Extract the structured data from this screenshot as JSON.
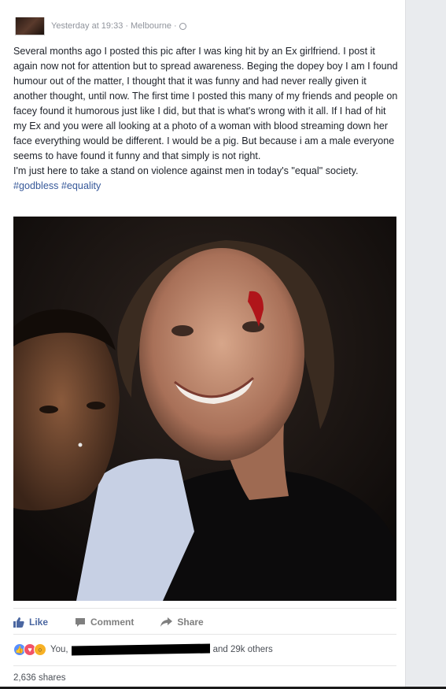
{
  "post": {
    "timestamp": "Yesterday at 19:33",
    "location": "Melbourne",
    "separator": "·",
    "privacy_icon": "globe-icon",
    "body": "Several months ago I posted this pic after I was king hit by an Ex girlfriend. I post it again now not for attention but to spread awareness. Beging the dopey boy I am I found humour out of the matter, I thought that it was funny and had never really given it another thought, until now. The first time I posted this many of my friends and people on facey found it humorous just like I did, but that is what's wrong with it all. If I had of hit my Ex and you were all looking at a photo of a woman with blood streaming down her face everything would be different. I would be a pig. But because i am a male everyone seems to have found it funny and that simply is not right.",
    "body2": "I'm just here to take a stand on violence against men in today's \"equal\" society.",
    "hashtags": [
      "#godbless",
      "#equality"
    ]
  },
  "actions": {
    "like": "Like",
    "comment": "Comment",
    "share": "Share"
  },
  "reactions": {
    "types": [
      "like",
      "love",
      "wow"
    ],
    "you": "You,",
    "others": "and 29k others"
  },
  "shares": "2,636 shares",
  "colors": {
    "link": "#365899",
    "like_blue": "#4b67a1",
    "text": "#1d2129",
    "meta": "#90949c"
  }
}
